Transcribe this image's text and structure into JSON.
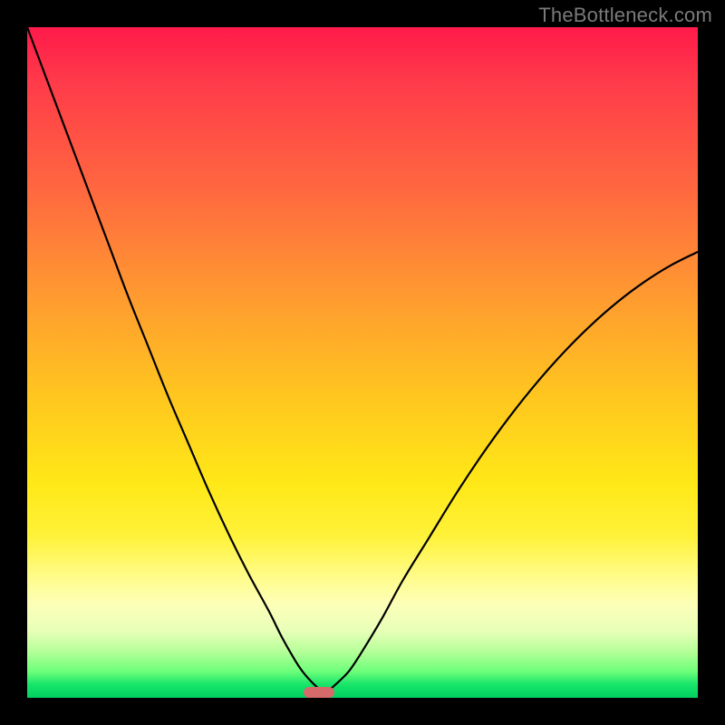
{
  "watermark": "TheBottleneck.com",
  "colors": {
    "frame": "#000000",
    "curve": "#000000",
    "marker": "#d46a6a",
    "gradient_stops": [
      "#ff1a4a",
      "#ff3a4a",
      "#ff6a3f",
      "#ff9a30",
      "#ffc61f",
      "#ffe817",
      "#fff23a",
      "#fffc8a",
      "#fdffb8",
      "#e8ffb8",
      "#b7ff9a",
      "#6fff7a",
      "#18e66a",
      "#00d060"
    ]
  },
  "chart_data": {
    "type": "line",
    "title": "",
    "xlabel": "",
    "ylabel": "",
    "xlim": [
      0,
      100
    ],
    "ylim": [
      0,
      100
    ],
    "x": [
      0,
      3,
      6,
      9,
      12,
      15,
      18,
      21,
      24,
      27,
      30,
      33,
      36,
      38,
      40,
      41,
      42,
      43,
      44,
      45,
      46,
      48,
      50,
      53,
      56,
      60,
      64,
      68,
      72,
      76,
      80,
      84,
      88,
      92,
      96,
      100
    ],
    "values": [
      100,
      92,
      84,
      76,
      68,
      60,
      52.5,
      45,
      38,
      31,
      24.5,
      18.5,
      13,
      9,
      5.5,
      4,
      2.8,
      1.8,
      1,
      1.2,
      2,
      4,
      7,
      12,
      17.5,
      24,
      30.5,
      36.5,
      42,
      47,
      51.5,
      55.5,
      59,
      62,
      64.5,
      66.5
    ],
    "marker": {
      "x": 43.5,
      "y": 0.8
    }
  }
}
